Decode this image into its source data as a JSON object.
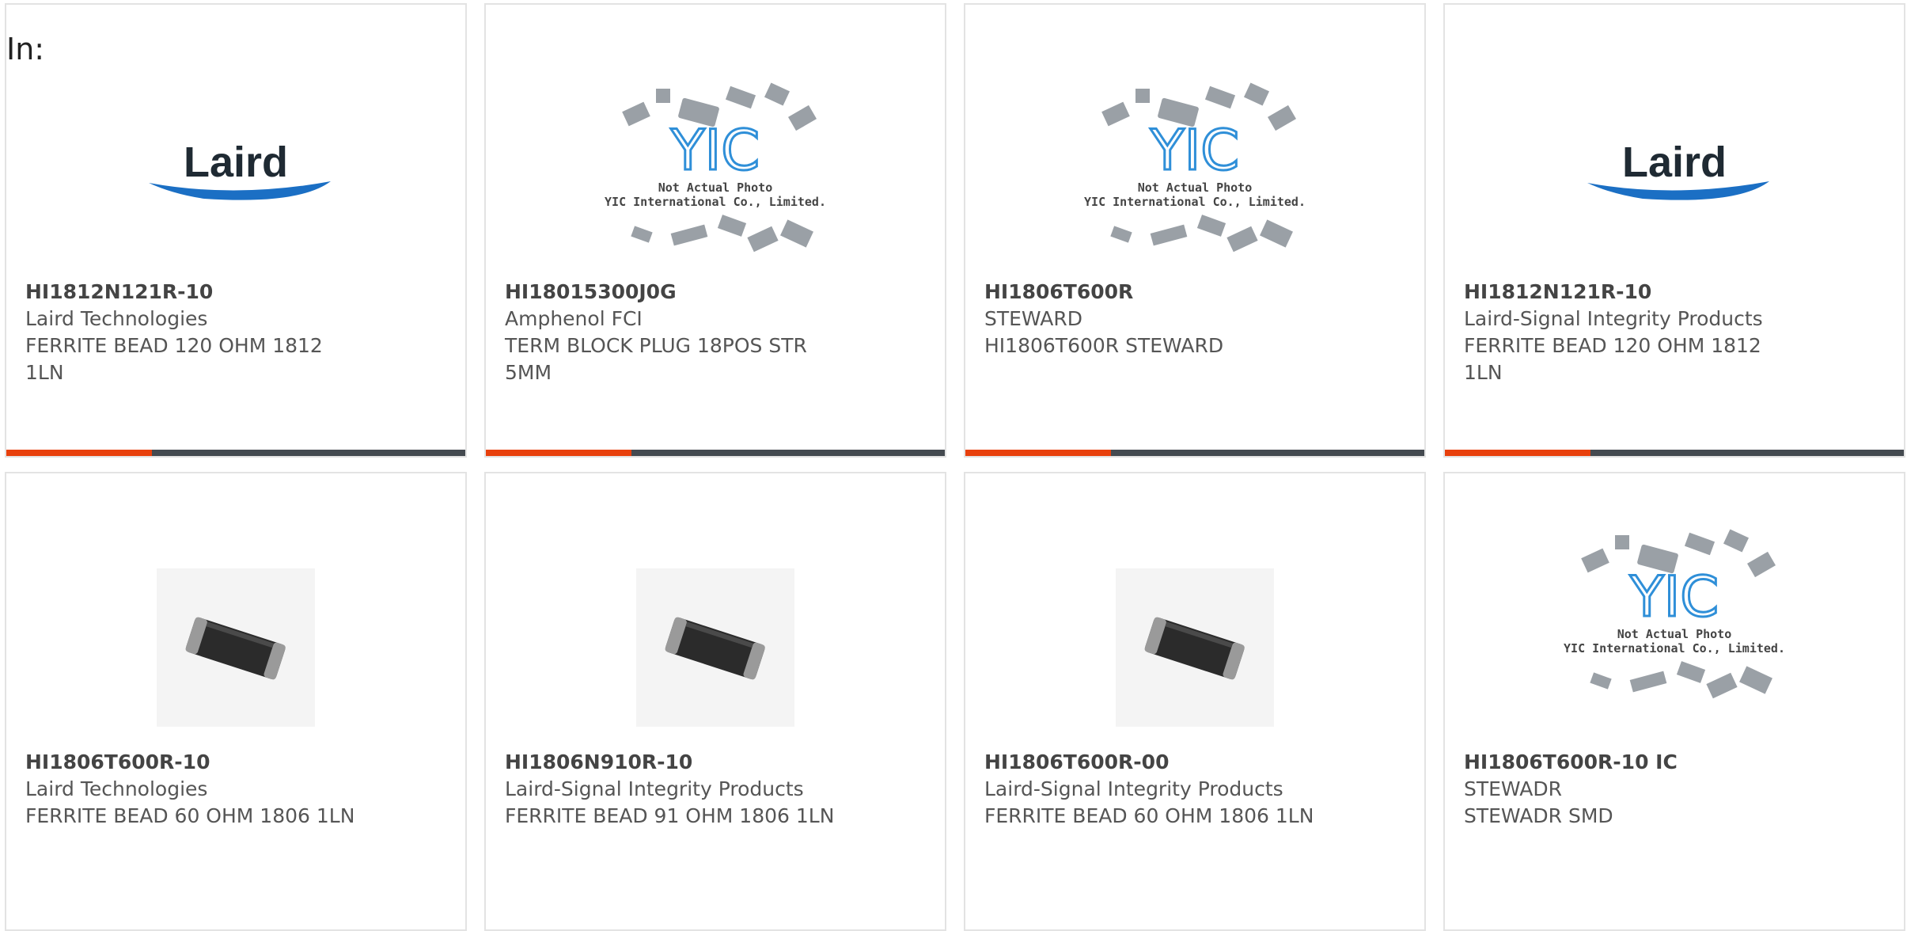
{
  "header": {
    "in_label": "In:"
  },
  "colors": {
    "accent": "#e8400c",
    "stripe_dark": "#444a50",
    "laird_blue": "#1b6fc4"
  },
  "products": [
    {
      "part": "HI1812N121R-10",
      "manufacturer": "Laird Technologies",
      "description": "FERRITE BEAD 120 OHM 1812 1LN",
      "image": "laird-logo"
    },
    {
      "part": "HI18015300J0G",
      "manufacturer": "Amphenol FCI",
      "description": "TERM BLOCK PLUG 18POS STR 5MM",
      "image": "yic-placeholder"
    },
    {
      "part": "HI1806T600R",
      "manufacturer": "STEWARD",
      "description": "HI1806T600R STEWARD",
      "image": "yic-placeholder"
    },
    {
      "part": "HI1812N121R-10",
      "manufacturer": "Laird-Signal Integrity Products",
      "description": "FERRITE BEAD 120 OHM 1812 1LN",
      "image": "laird-logo"
    },
    {
      "part": "HI1806T600R-10",
      "manufacturer": "Laird Technologies",
      "description": "FERRITE BEAD 60 OHM 1806 1LN",
      "image": "ferrite-bead-photo"
    },
    {
      "part": "HI1806N910R-10",
      "manufacturer": "Laird-Signal Integrity Products",
      "description": "FERRITE BEAD 91 OHM 1806 1LN",
      "image": "ferrite-bead-photo"
    },
    {
      "part": "HI1806T600R-00",
      "manufacturer": "Laird-Signal Integrity Products",
      "description": "FERRITE BEAD 60 OHM 1806 1LN",
      "image": "ferrite-bead-photo"
    },
    {
      "part": "HI1806T600R-10 IC",
      "manufacturer": "STEWADR",
      "description": "STEWADR SMD",
      "image": "yic-placeholder"
    }
  ],
  "yic": {
    "brand": "YIC",
    "line1": "Not Actual Photo",
    "line2": "YIC International Co., Limited."
  },
  "laird": {
    "brand": "Laird"
  }
}
